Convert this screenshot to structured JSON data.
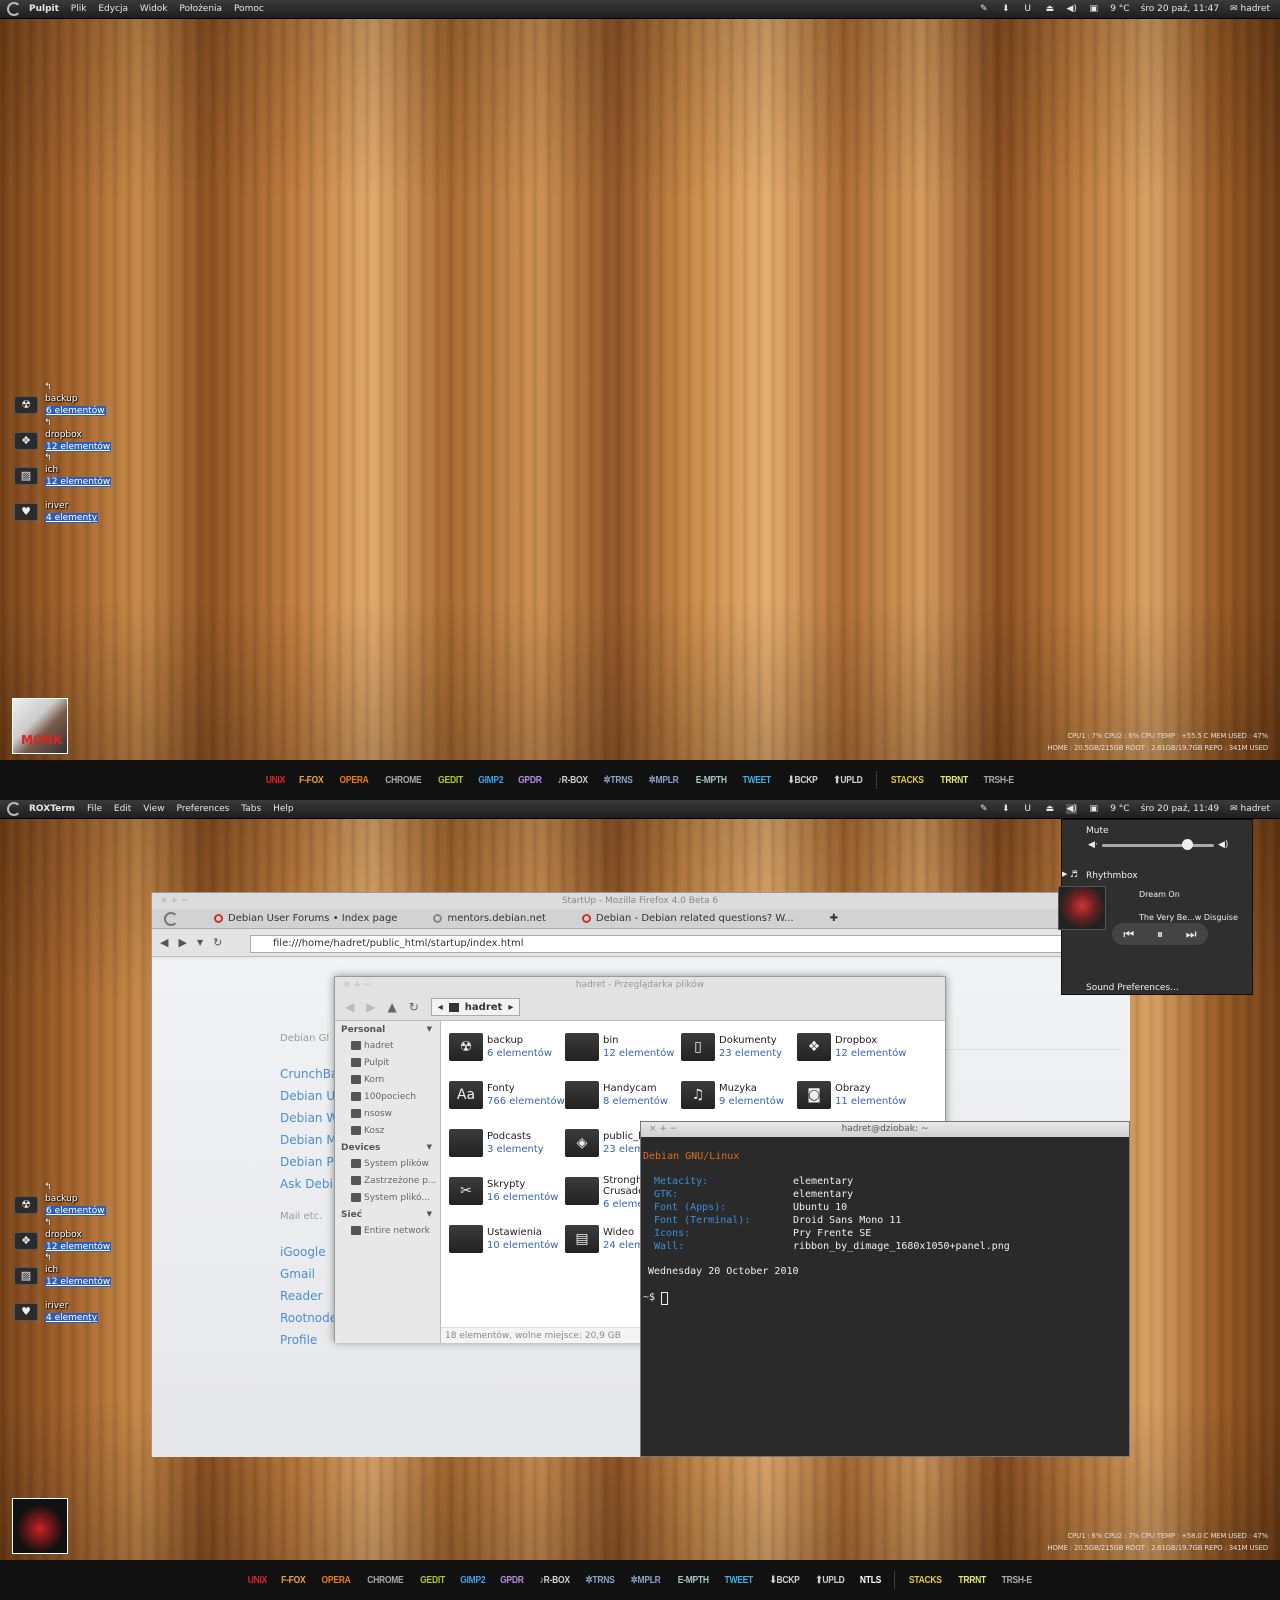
{
  "shot1": {
    "panel": {
      "app": "Pulpit",
      "menus": [
        "Plik",
        "Edycja",
        "Widok",
        "Położenia",
        "Pomoc"
      ],
      "temp": "9 °C",
      "clock": "śro 20 paź, 11:47",
      "user": "hadret"
    },
    "desktop_items": [
      {
        "name": "backup",
        "count": "6 elementów",
        "icon": "radiation-icon"
      },
      {
        "name": "dropbox",
        "count": "12 elementów",
        "icon": "dropbox-icon"
      },
      {
        "name": "ich",
        "count": "12 elementów",
        "icon": "picture-icon"
      },
      {
        "name": "iriver",
        "count": "4 elementy",
        "icon": "heart-icon"
      }
    ],
    "cover_text": "MONK",
    "conky": {
      "line1": "CPU1 : 7%   CPU2 : 6%   CPU TEMP : +55.5 C   MEM USED : 47%",
      "line2": "HOME : 20.5GB/215GB   ROOT : 2.61GB/19.7GB   REPO : 341M USED"
    }
  },
  "shot2": {
    "panel": {
      "app": "ROXTerm",
      "menus": [
        "File",
        "Edit",
        "View",
        "Preferences",
        "Tabs",
        "Help"
      ],
      "temp": "9 °C",
      "clock": "śro 20 paź, 11:49",
      "user": "hadret"
    },
    "firefox": {
      "title": "StartUp - Mozilla Firefox 4.0 Beta 6",
      "tabs": [
        "Debian User Forums • Index page",
        "mentors.debian.net",
        "Debian - Debian related questions? W..."
      ],
      "url": "file:///home/hadret/public_html/startup/index.html",
      "heading1": "Debian Gl",
      "links1": [
        "CrunchBa",
        "Debian U",
        "Debian W",
        "Debian M",
        "Debian P",
        "Ask Debi"
      ],
      "heading2": "Mail etc.",
      "links2": [
        "iGoogle",
        "Gmail",
        "Reader",
        "Rootnode",
        "Profile"
      ]
    },
    "nautilus": {
      "title": "hadret - Przeglądarka plików",
      "crumb": "hadret",
      "sidebar": {
        "personal": "Personal",
        "personal_items": [
          "hadret",
          "Pulpit",
          "Korn",
          "100pociech",
          "nsosw",
          "Kosz"
        ],
        "devices": "Devices",
        "device_items": [
          "System plików",
          "Zastrzeżone p...",
          "System plikó..."
        ],
        "network": "Sieć",
        "network_items": [
          "Entire network"
        ]
      },
      "files": [
        {
          "name": "backup",
          "count": "6 elementów"
        },
        {
          "name": "bin",
          "count": "12 elementów"
        },
        {
          "name": "Dokumenty",
          "count": "23 elementy"
        },
        {
          "name": "Dropbox",
          "count": "12 elementów"
        },
        {
          "name": "Fonty",
          "count": "766 elementów"
        },
        {
          "name": "Handycam",
          "count": "8 elementów"
        },
        {
          "name": "Muzyka",
          "count": "9 elementów"
        },
        {
          "name": "Obrazy",
          "count": "11 elementów"
        },
        {
          "name": "Podcasts",
          "count": "3 elementy"
        },
        {
          "name": "public_html",
          "count": "23 elem"
        },
        {
          "name": "Skrypty",
          "count": "16 elementów"
        },
        {
          "name": "Stronghold Crusader",
          "count": "6 eleme"
        },
        {
          "name": "Ustawienia",
          "count": "10 elementów"
        },
        {
          "name": "Wideo",
          "count": "24 elem"
        }
      ],
      "status": "18 elementów, wolne miejsce: 20,9 GB"
    },
    "terminal": {
      "title": "hadret@dziobak: ~",
      "distro": "Debian GNU/Linux",
      "rows": [
        {
          "k": "Metacity:",
          "v": "elementary"
        },
        {
          "k": "GTK:",
          "v": "elementary"
        },
        {
          "k": "Font (Apps):",
          "v": "Ubuntu 10"
        },
        {
          "k": "Font (Terminal):",
          "v": "Droid Sans Mono 11"
        },
        {
          "k": "Icons:",
          "v": "Pry Frente SE"
        },
        {
          "k": "Wall:",
          "v": "ribbon_by_dimage_1680x1050+panel.png"
        }
      ],
      "date": "Wednesday 20 October 2010",
      "prompt": "~$"
    },
    "sound": {
      "mute": "Mute",
      "volume": 0.76,
      "player": "Rhythmbox",
      "track": "Dream On",
      "album": "The Very Be...w Disguise",
      "prefs": "Sound Preferences..."
    },
    "conky": {
      "line1": "CPU1 : 6%   CPU2 : 7%   CPU TEMP : +58.0 C   MEM USED : 47%",
      "line2": "HOME : 20.5GB/215GB   ROOT : 2.61GB/19.7GB   REPO : 341M USED"
    }
  },
  "dock": [
    {
      "label": "UNIX",
      "color": "#e0242a"
    },
    {
      "label": "F-FOX",
      "color": "#f2a22c"
    },
    {
      "label": "OPERA",
      "color": "#f07a10"
    },
    {
      "label": "CHROME",
      "color": "#a8a8a8"
    },
    {
      "label": "GEDIT",
      "color": "#b5c422"
    },
    {
      "label": "GIMP2",
      "color": "#3aa3e8"
    },
    {
      "label": "GPDR",
      "color": "#b58ae0"
    },
    {
      "label": "♪R-BOX",
      "color": "#cfcfcf"
    },
    {
      "label": "✲TRNS",
      "color": "#8aa3c8"
    },
    {
      "label": "✲MPLR",
      "color": "#8aa3c8"
    },
    {
      "label": "E-MPTH",
      "color": "#9fc8c0"
    },
    {
      "label": "TWEET",
      "color": "#3ab2e8"
    },
    {
      "label": "⬇BCKP",
      "color": "#cfcfcf"
    },
    {
      "label": "⬆UPLD",
      "color": "#cfcfcf"
    }
  ],
  "dock_extra": "NTLS",
  "dock_right": [
    {
      "label": "STACKS",
      "color": "#e8c83a"
    },
    {
      "label": "TRRNT",
      "color": "#e8e86a"
    },
    {
      "label": "TRSH-E",
      "color": "#a8a8a8"
    }
  ]
}
